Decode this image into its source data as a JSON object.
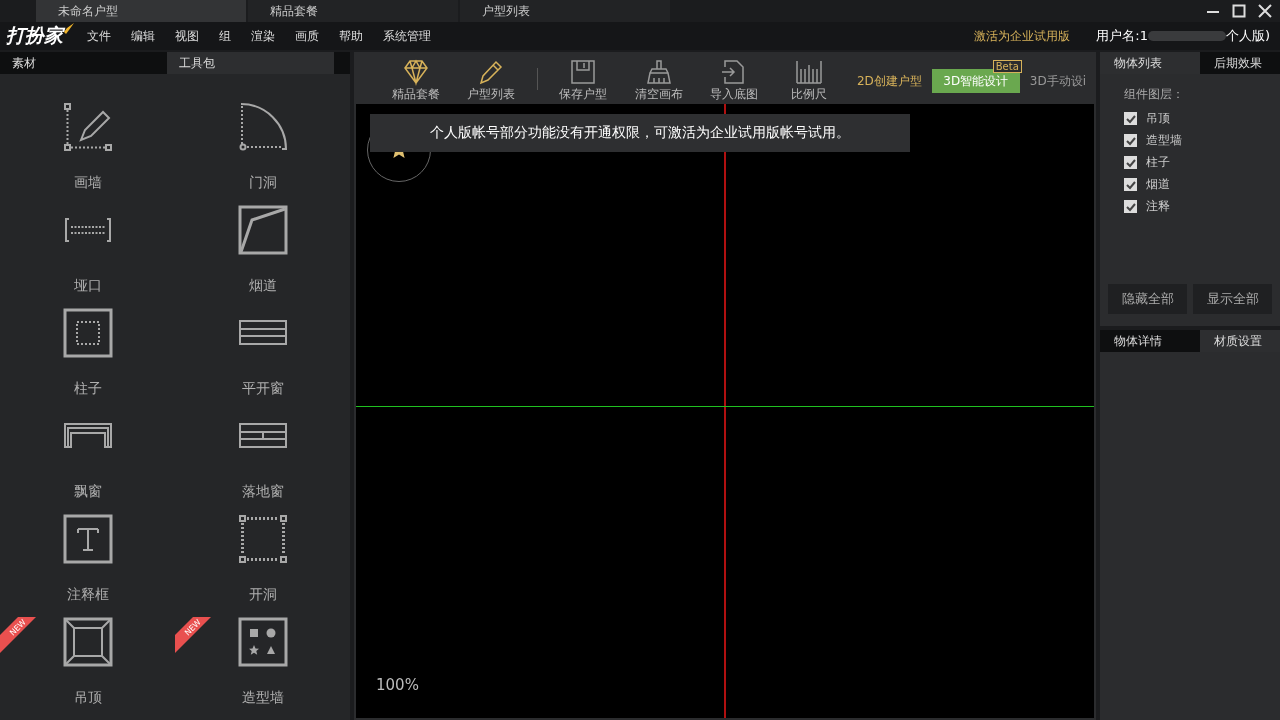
{
  "doc_tabs": [
    {
      "label": "未命名户型",
      "selected": true
    },
    {
      "label": "精品套餐",
      "selected": false
    },
    {
      "label": "户型列表",
      "selected": false
    }
  ],
  "logo": "打扮家",
  "menu": [
    "文件",
    "编辑",
    "视图",
    "组",
    "渲染",
    "画质",
    "帮助",
    "系统管理"
  ],
  "activate_link": "激活为企业试用版",
  "user": {
    "prefix": "用户名:1",
    "suffix": "个人版)"
  },
  "left_tabs": [
    {
      "label": "素材",
      "selected": false
    },
    {
      "label": "工具包",
      "selected": true
    }
  ],
  "tools": [
    {
      "label": "画墙",
      "kind": "wall",
      "new": false
    },
    {
      "label": "门洞",
      "kind": "door",
      "new": false
    },
    {
      "label": "垭口",
      "kind": "opening",
      "new": false
    },
    {
      "label": "烟道",
      "kind": "flue",
      "new": false
    },
    {
      "label": "柱子",
      "kind": "pillar",
      "new": false
    },
    {
      "label": "平开窗",
      "kind": "window",
      "new": false
    },
    {
      "label": "飘窗",
      "kind": "bay",
      "new": false
    },
    {
      "label": "落地窗",
      "kind": "floor-window",
      "new": false
    },
    {
      "label": "注释框",
      "kind": "text",
      "new": false
    },
    {
      "label": "开洞",
      "kind": "hole",
      "new": false
    },
    {
      "label": "吊顶",
      "kind": "ceiling",
      "new": true,
      "badge": "NEW"
    },
    {
      "label": "造型墙",
      "kind": "shapes",
      "new": true,
      "badge": "NEW"
    }
  ],
  "toolbar": [
    {
      "label": "精品套餐",
      "kind": "diamond",
      "accent": true
    },
    {
      "label": "户型列表",
      "kind": "pencil",
      "accent": true
    },
    {
      "label": "保存户型",
      "kind": "save",
      "accent": false
    },
    {
      "label": "清空画布",
      "kind": "broom",
      "accent": false
    },
    {
      "label": "导入底图",
      "kind": "import",
      "accent": false
    },
    {
      "label": "比例尺",
      "kind": "ruler",
      "accent": false
    }
  ],
  "modes": [
    {
      "label": "2D创建户型",
      "selected": false,
      "highlighted": true
    },
    {
      "label": "3D智能设计",
      "selected": true,
      "highlighted": false,
      "badge": "Beta"
    },
    {
      "label": "3D手动设i",
      "selected": false,
      "highlighted": false
    }
  ],
  "notice": "个人版帐号部分功能没有开通权限，可激活为企业试用版帐号试用。",
  "zoom": "100%",
  "right_tabs": [
    {
      "label": "物体列表",
      "selected": true
    },
    {
      "label": "后期效果",
      "selected": false
    }
  ],
  "layers": {
    "title": "组件图层：",
    "items": [
      {
        "label": "吊顶",
        "checked": true
      },
      {
        "label": "造型墙",
        "checked": true
      },
      {
        "label": "柱子",
        "checked": true
      },
      {
        "label": "烟道",
        "checked": true
      },
      {
        "label": "注释",
        "checked": true
      }
    ]
  },
  "layer_buttons": [
    "隐藏全部",
    "显示全部"
  ],
  "detail_tabs": [
    {
      "label": "物体详情",
      "selected": false
    },
    {
      "label": "材质设置",
      "selected": true
    }
  ]
}
